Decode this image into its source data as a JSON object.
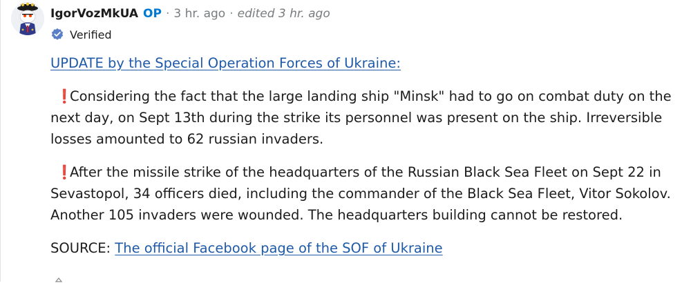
{
  "comment": {
    "author": "IgorVozMkUA",
    "op_badge": "OP",
    "separator": "·",
    "time": "3 hr. ago",
    "edited": "edited 3 hr. ago",
    "flair": {
      "icon": "verified-badge-icon",
      "label": "Verified"
    }
  },
  "body": {
    "headline_link": "UPDATE by the Special Operation Forces of Ukraine:",
    "exclamation": "❗",
    "para1": "Considering the fact that the large landing ship \"Minsk\" had to go on combat duty on the next day, on Sept 13th during the strike its personnel was present on the ship. Irreversible losses amounted to 62 russian invaders.",
    "para2": "After the missile strike of the headquarters of the Russian Black Sea Fleet on Sept 22 in Sevastopol, 34 officers died, including the commander of the Black Sea Fleet, Vitor Sokolov. Another 105 invaders were wounded. The headquarters building cannot be restored.",
    "source_label": "SOURCE:",
    "source_link": "The official Facebook page of the SOF of Ukraine"
  },
  "colors": {
    "link": "#1e5aa8",
    "op": "#0079d3",
    "meta": "#787c7e",
    "verified": "#5b7fc7",
    "exclamation": "#e02020"
  }
}
